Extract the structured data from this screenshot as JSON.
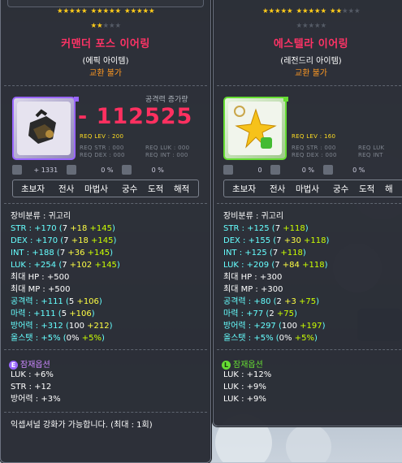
{
  "colors": {
    "epic": "#9966ff",
    "legendary": "#66dd33",
    "name": "#ff3366",
    "trade": "#ff9922",
    "base": "#66ffff",
    "scroll": "#ffff44",
    "flame": "#ccff00"
  },
  "left": {
    "stars": {
      "filled": 17,
      "total": 20
    },
    "name": "커맨더 포스 이어링",
    "grade": "(에픽 아이템)",
    "trade": "교환 불가",
    "attack_label": "공격력 증가량",
    "attack_change": "- 112525",
    "icon": "anchor-earring-icon",
    "req_lev": "REQ LEV : 200",
    "req_str": "REQ STR : 000",
    "req_luk": "REQ LUK : 000",
    "req_dex": "REQ DEX : 000",
    "req_int": "REQ INT : 000",
    "flag_values": [
      "+ 1331",
      "0 %",
      "0 %"
    ],
    "jobs": [
      "초보자",
      "전사",
      "마법사",
      "궁수",
      "도적",
      "해적"
    ],
    "category": "장비분류 : 귀고리",
    "stats": [
      {
        "label": "STR : +170 (",
        "base": "7",
        "scroll": "+18",
        "flame": "+145",
        "close": ")"
      },
      {
        "label": "DEX : +170 (",
        "base": "7",
        "scroll": "+18",
        "flame": "+145",
        "close": ")"
      },
      {
        "label": "INT : +188 (",
        "base": "7",
        "scroll": "+36",
        "flame": "+145",
        "close": ")"
      },
      {
        "label": "LUK : +254 (",
        "base": "7",
        "scroll": "+102",
        "flame": "+145",
        "close": ")"
      }
    ],
    "hp": "최대 HP : +500",
    "mp": "최대 MP : +500",
    "atk": {
      "label": "공격력 : +111 (",
      "base": "5",
      "scroll": "+106",
      "close": ")"
    },
    "matk": {
      "label": "마력 : +111 (",
      "base": "5",
      "scroll": "+106",
      "close": ")"
    },
    "def": {
      "label": "방어력 : +312 (",
      "base": "100",
      "scroll": "+212",
      "close": ")"
    },
    "allstat": {
      "label": "올스탯 : +5% (",
      "base": "0%",
      "flame": "+5%",
      "close": ")"
    },
    "potential_badge": "E",
    "potential_title": "잠재옵션",
    "potentials": [
      "LUK : +6%",
      "STR : +12",
      "방어력 : +3%"
    ],
    "footer": "익셉셔널 강화가 가능합니다. (최대 : 1회)"
  },
  "right": {
    "stars": {
      "filled": 12,
      "total": 20
    },
    "name": "에스텔라 이어링",
    "grade": "(레전드리 아이템)",
    "trade": "교환 불가",
    "icon": "star-earring-icon",
    "req_lev": "REQ LEV : 160",
    "req_str": "REQ STR : 000",
    "req_luk": "REQ LUK",
    "req_dex": "REQ DEX : 000",
    "req_int": "REQ INT",
    "flag_values": [
      "0",
      "0 %",
      "0 %"
    ],
    "jobs": [
      "초보자",
      "전사",
      "마법사",
      "궁수",
      "도적",
      "해"
    ],
    "category": "장비분류 : 귀고리",
    "stats": [
      {
        "label": "STR : +125 (",
        "base": "7",
        "scroll": "",
        "flame": "+118",
        "close": ")"
      },
      {
        "label": "DEX : +155 (",
        "base": "7",
        "scroll": "+30",
        "flame": "+118",
        "close": ")"
      },
      {
        "label": "INT : +125 (",
        "base": "7",
        "scroll": "",
        "flame": "+118",
        "close": ")"
      },
      {
        "label": "LUK : +209 (",
        "base": "7",
        "scroll": "+84",
        "flame": "+118",
        "close": ")"
      }
    ],
    "hp": "최대 HP : +300",
    "mp": "최대 MP : +300",
    "atk": {
      "label": "공격력 : +80 (",
      "base": "2",
      "scroll": "+3",
      "flame": "+75",
      "close": ")"
    },
    "matk": {
      "label": "마력 : +77 (",
      "base": "2",
      "flame": "+75",
      "close": ")"
    },
    "def": {
      "label": "방어력 : +297 (",
      "base": "100",
      "flame": "+197",
      "close": ")"
    },
    "allstat": {
      "label": "올스탯 : +5% (",
      "base": "0%",
      "flame": "+5%",
      "close": ")"
    },
    "potential_badge": "L",
    "potential_title": "잠재옵션",
    "potentials": [
      "LUK : +12%",
      "LUK : +9%",
      "LUK : +9%"
    ]
  }
}
